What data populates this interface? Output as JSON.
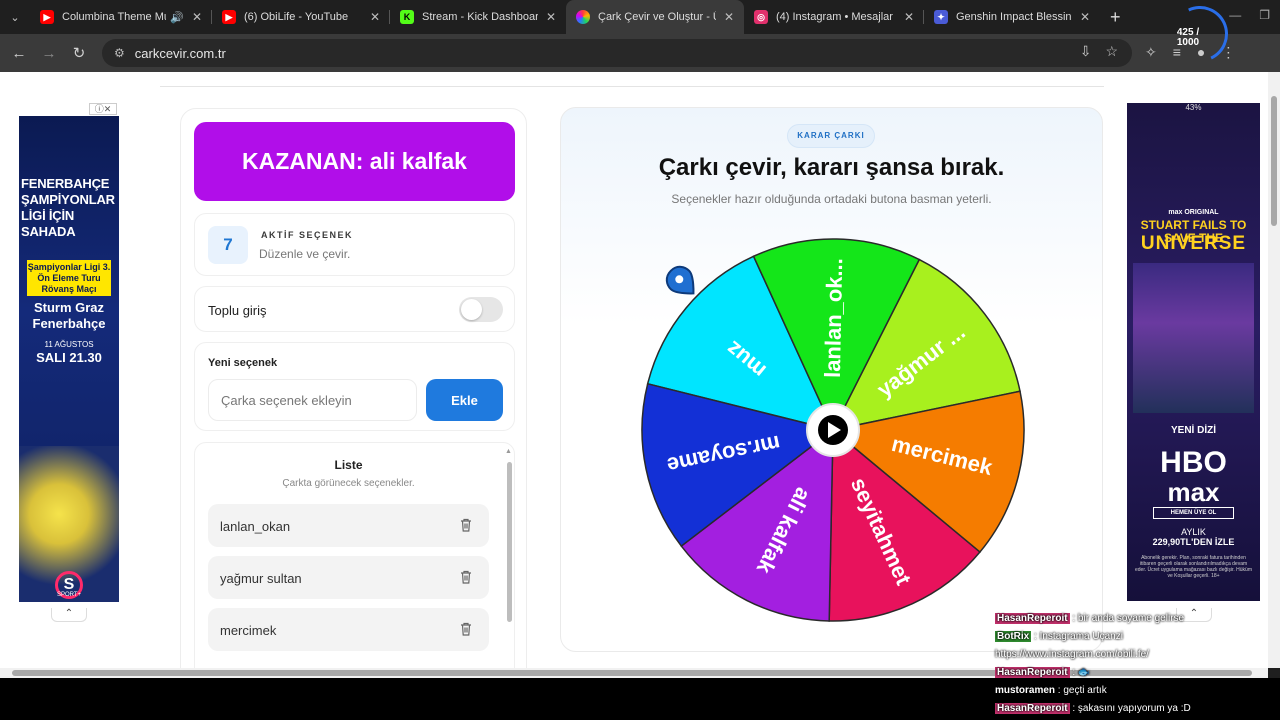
{
  "browser": {
    "tabs": [
      {
        "title": "Columbina Theme Mus",
        "favicon": "youtube-icon",
        "color": "#ff0000"
      },
      {
        "title": "(6) ObiLife - YouTube",
        "favicon": "youtube-icon",
        "color": "#ff0000"
      },
      {
        "title": "Stream - Kick Dashboard",
        "favicon": "kick-icon",
        "color": "#53fc18"
      },
      {
        "title": "Çark Çevir ve Oluştur - Ücr",
        "favicon": "wheel-icon",
        "color": "#ffb300"
      },
      {
        "title": "(4) Instagram • Mesajlar",
        "favicon": "instagram-icon",
        "color": "#e1306c"
      },
      {
        "title": "Genshin Impact Blessing o",
        "favicon": "genshin-icon",
        "color": "#4a5bd6"
      }
    ],
    "url": "carkcevir.com.tr",
    "counter": "425 / 1000"
  },
  "winner": {
    "label": "KAZANAN: ali kalfak"
  },
  "active_options": {
    "count": "7",
    "label": "AKTİF SEÇENEK",
    "sub": "Düzenle ve çevir."
  },
  "bulk_entry": {
    "label": "Toplu giriş"
  },
  "new_option": {
    "label": "Yeni seçenek",
    "placeholder": "Çarka seçenek ekleyin",
    "button": "Ekle"
  },
  "list": {
    "title": "Liste",
    "sub": "Çarkta görünecek seçenekler.",
    "items": [
      "lanlan_okan",
      "yağmur sultan",
      "mercimek"
    ]
  },
  "wheel_panel": {
    "chip": "KARAR ÇARKI",
    "headline": "Çarkı çevir, kararı şansa bırak.",
    "sub": "Seçenekler hazır olduğunda ortadaki butona basman yeterli.",
    "segments": [
      {
        "label": "muz",
        "color": "#00e5ff"
      },
      {
        "label": "lanlan_ok...",
        "color": "#14e619"
      },
      {
        "label": "yağmur ...",
        "color": "#a8f01e"
      },
      {
        "label": "mercimek",
        "color": "#f57c00"
      },
      {
        "label": "seyitahmet",
        "color": "#e8125c"
      },
      {
        "label": "ali kalfak",
        "color": "#a31fe0"
      },
      {
        "label": "mr.soyame",
        "color": "#1330d6"
      }
    ]
  },
  "ads": {
    "left": {
      "headline": "FENERBAHÇE ŞAMPİYONLAR LİGİ İÇİN SAHADA",
      "box": "Şampiyonlar Ligi 3. Ön Eleme Turu Rövanş Maçı",
      "match": "Sturm Graz Fenerbahçe",
      "date": "11 AĞUSTOS",
      "time": "SALI 21.30",
      "brand": "SPORT+"
    },
    "right": {
      "top": "43%",
      "max_original": "max ORIGINAL",
      "title1": "STUART FAILS TO SAVE THE",
      "title2": "UNIVERSE",
      "yeni": "YENİ DİZİ",
      "hbo": "HBO",
      "max": "max",
      "cta": "HEMEN ÜYE OL",
      "price_label": "AYLIK",
      "price": "229,90TL'DEN İZLE",
      "legal": "Abonelik gerekir. Plan, sonraki fatura tarihinden itibaren geçerli olarak sonlandırılmadıkça devam eder. Ücret uygulama mağazası bazlı değişir. Hüküm ve Koşullar geçerli. 18+"
    }
  },
  "chat": [
    {
      "user": "HasanReperoit",
      "msg": " : bir anda soyame gelirse",
      "style": "hasan"
    },
    {
      "user": "BotRix",
      "msg": " : Instagrama Uçanzi https://www.instagram.com/obili.fe/",
      "style": "bot"
    },
    {
      "user": "HasanReperoit",
      "msg": " : 🐟",
      "style": "hasan"
    },
    {
      "user": "mustoramen",
      "msg": " : geçti artık",
      "style": "plain"
    },
    {
      "user": "HasanReperoit",
      "msg": " : şakasını yapıyorum ya :D",
      "style": "hasan"
    }
  ]
}
